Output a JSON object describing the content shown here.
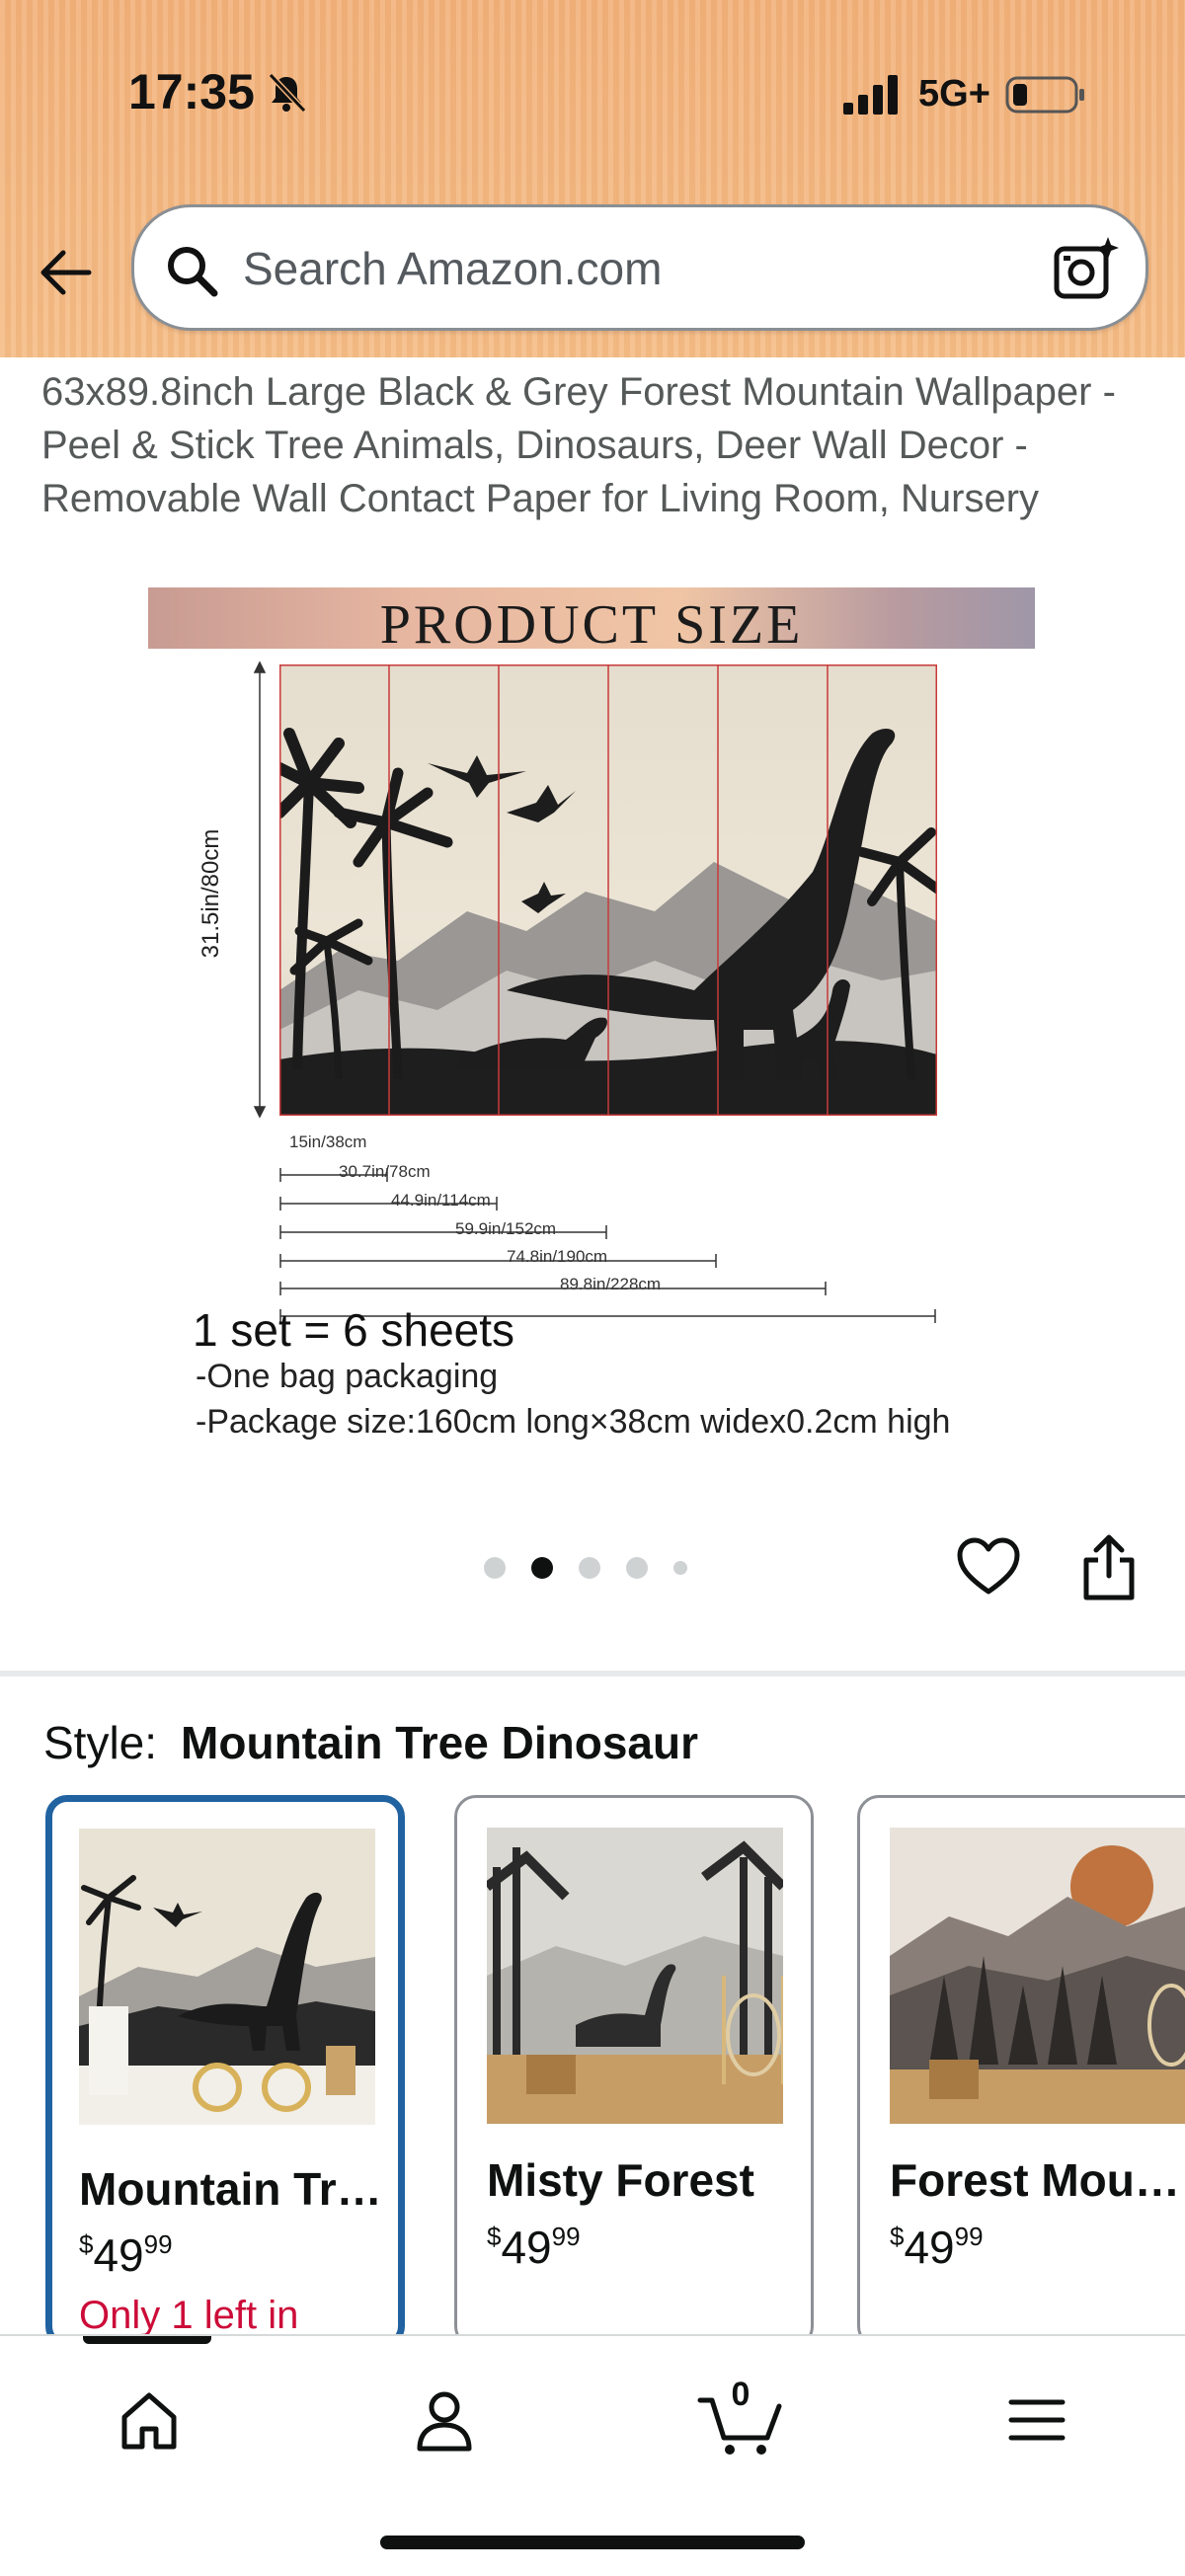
{
  "status_bar": {
    "time": "17:35",
    "network": "5G+",
    "icons": [
      "bell-muted-icon",
      "signal-icon",
      "battery-icon"
    ]
  },
  "header": {
    "back_icon": "arrow-left-icon",
    "search": {
      "placeholder": "Search Amazon.com",
      "icons": [
        "search-icon",
        "camera-lens-icon"
      ]
    },
    "background_color": "#f3b57c"
  },
  "product": {
    "title": "63x89.8inch Large Black & Grey Forest Mountain Wallpaper - Peel & Stick Tree Animals, Dinosaurs, Deer Wall Decor - Removable Wall Contact Paper for Living Room, Nursery",
    "image": {
      "banner_title": "PRODUCT SIZE",
      "height_label": "31.5in/80cm",
      "width_labels": [
        "15in/38cm",
        "30.7in/78cm",
        "44.9in/114cm",
        "59.9in/152cm",
        "74.8in/190cm",
        "89.8in/228cm"
      ],
      "sets": "1 set = 6 sheets",
      "packaging_lines": [
        "-One bag packaging",
        "-Package size:160cm long×38cm widex0.2cm high"
      ]
    },
    "carousel": {
      "total": 5,
      "active_index": 1
    },
    "actions": [
      "heart-icon",
      "share-icon"
    ]
  },
  "style": {
    "label": "Style:",
    "selected": "Mountain Tree Dinosaur",
    "options": [
      {
        "name": "Mountain Tree Dinosaur",
        "price_symbol": "$",
        "price_whole": "49",
        "price_fraction": "99",
        "stock": "Only 1 left in",
        "selected": true
      },
      {
        "name": "Misty Forest",
        "price_symbol": "$",
        "price_whole": "49",
        "price_fraction": "99",
        "selected": false
      },
      {
        "name": "Forest Mountain",
        "price_symbol": "$",
        "price_whole": "49",
        "price_fraction": "99",
        "selected": false
      }
    ],
    "accent_color": "#2162a1",
    "stock_color": "#cc0c39"
  },
  "bottom_nav": {
    "items": [
      "home-icon",
      "account-icon",
      "cart-icon",
      "menu-icon"
    ],
    "cart_count": "0"
  }
}
